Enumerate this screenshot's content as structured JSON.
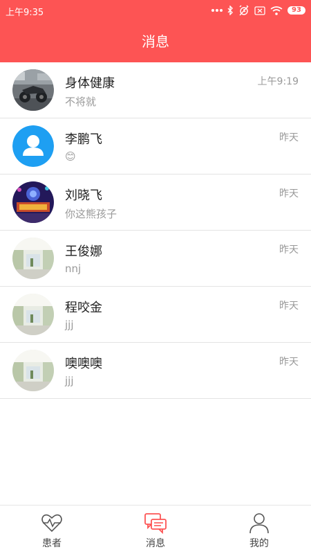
{
  "status_bar": {
    "time": "上午9:35",
    "battery": "93",
    "icons": [
      "more-dots-icon",
      "bluetooth-icon",
      "alarm-off-icon",
      "sim-icon",
      "wifi-icon",
      "battery-icon"
    ]
  },
  "header": {
    "title": "消息"
  },
  "conversations": [
    {
      "name": "身体健康",
      "preview": "不将就",
      "time": "上午9:19",
      "avatar": "photo-motorcycle"
    },
    {
      "name": "李鹏飞",
      "preview": "😊",
      "time": "昨天",
      "avatar": "default-user"
    },
    {
      "name": "刘晓飞",
      "preview": "你这熊孩子",
      "time": "昨天",
      "avatar": "photo-game"
    },
    {
      "name": "王俊娜",
      "preview": "nnj",
      "time": "昨天",
      "avatar": "photo-hall"
    },
    {
      "name": "程咬金",
      "preview": "jjj",
      "time": "昨天",
      "avatar": "photo-hall"
    },
    {
      "name": "噢噢噢",
      "preview": "jjj",
      "time": "昨天",
      "avatar": "photo-hall"
    }
  ],
  "tabs": [
    {
      "label": "患者",
      "icon": "heartbeat-icon",
      "active": false
    },
    {
      "label": "消息",
      "icon": "chat-icon",
      "active": true
    },
    {
      "label": "我的",
      "icon": "person-icon",
      "active": false
    }
  ],
  "colors": {
    "primary": "#fd5454",
    "avatar_default": "#1e9ff2",
    "divider": "#e3e3e3",
    "muted_text": "#999999"
  }
}
